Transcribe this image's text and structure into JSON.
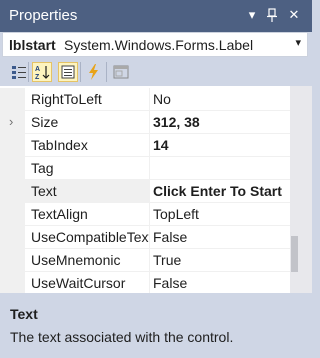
{
  "window": {
    "title": "Properties",
    "dropdown_glyph": "▾",
    "pin_glyph": "⊥",
    "close_glyph": "✕"
  },
  "object_selector": {
    "name": "lblstart",
    "type": "System.Windows.Forms.Label",
    "chevron": "▾"
  },
  "toolbar": {
    "buttons": [
      {
        "icon": "categorized-icon",
        "active": false
      },
      {
        "icon": "alphabetical-sort-icon",
        "active": true
      },
      {
        "icon": "properties-icon",
        "active": true
      },
      {
        "icon": "events-lightning-icon",
        "active": false
      },
      {
        "icon": "property-pages-icon",
        "active": false
      }
    ]
  },
  "properties": [
    {
      "name": "RightToLeft",
      "value": "No",
      "bold": false
    },
    {
      "name": "Size",
      "value": "312, 38",
      "bold": true,
      "expander": "›"
    },
    {
      "name": "TabIndex",
      "value": "14",
      "bold": true
    },
    {
      "name": "Tag",
      "value": "",
      "bold": false
    },
    {
      "name": "Text",
      "value": "Click Enter To Start",
      "bold": true,
      "selected": true
    },
    {
      "name": "TextAlign",
      "value": "TopLeft",
      "bold": false
    },
    {
      "name": "UseCompatibleTextRendering",
      "value": "False",
      "bold": false
    },
    {
      "name": "UseMnemonic",
      "value": "True",
      "bold": false
    },
    {
      "name": "UseWaitCursor",
      "value": "False",
      "bold": false
    }
  ],
  "description": {
    "title": "Text",
    "text": "The text associated with the control."
  },
  "colors": {
    "titlebar": "#4d6082",
    "panel": "#cfd6e5",
    "grid_line": "#f0f0f0"
  }
}
